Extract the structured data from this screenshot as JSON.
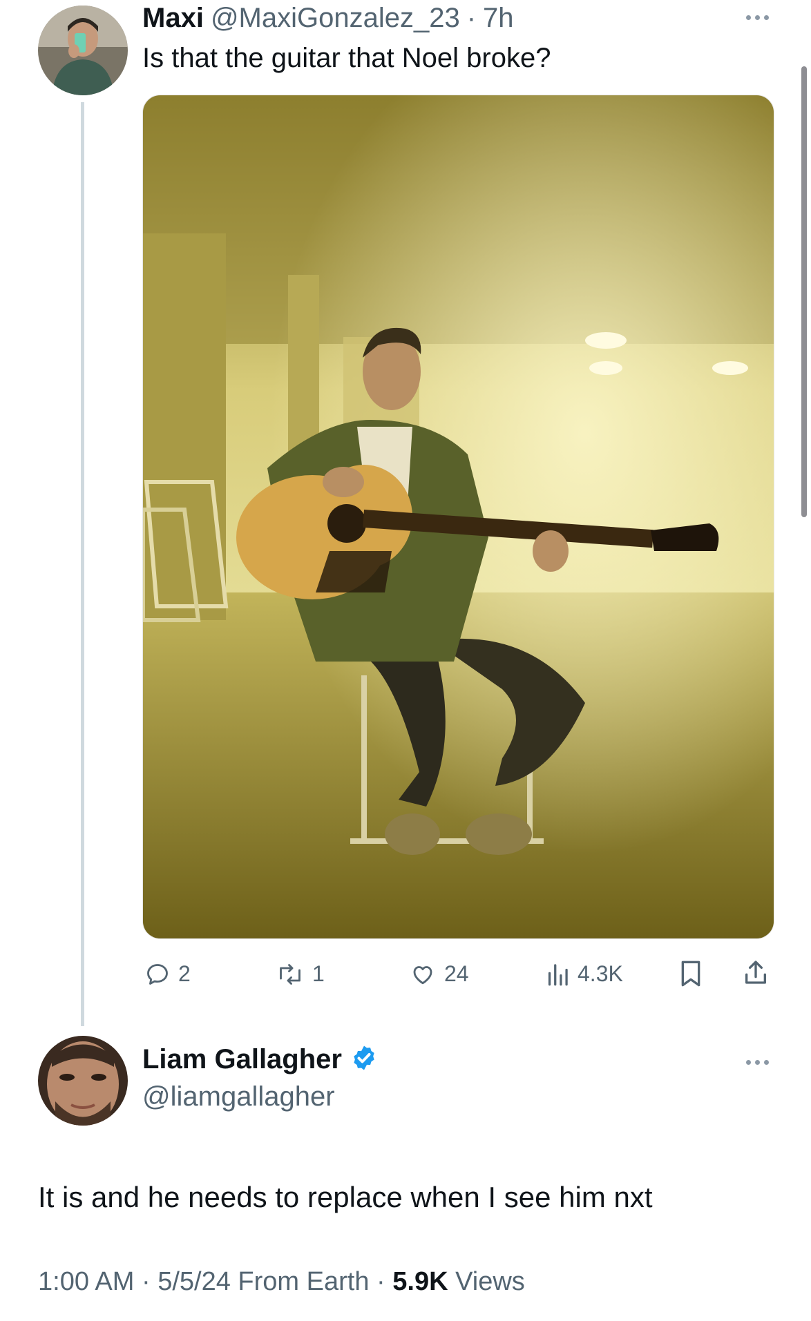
{
  "reply_tweet": {
    "author_name": "Maxi",
    "author_handle": "@MaxiGonzalez_23",
    "separator": "·",
    "time": "7h",
    "text": "Is that the guitar that Noel broke?",
    "actions": {
      "replies": "2",
      "retweets": "1",
      "likes": "24",
      "views": "4.3K"
    }
  },
  "main_tweet": {
    "author_name": "Liam Gallagher",
    "author_handle": "@liamgallagher",
    "text": "It is and he needs to replace when I see him nxt",
    "time": "1:00 AM",
    "sep1": "·",
    "date": "5/5/24",
    "source": "From Earth",
    "sep2": "·",
    "views": "5.9K",
    "views_label": "Views"
  },
  "icons": {
    "verified": "verified-badge-icon",
    "reply": "reply-icon",
    "retweet": "retweet-icon",
    "like": "heart-icon",
    "views": "views-chart-icon",
    "bookmark": "bookmark-icon",
    "share": "share-icon",
    "more": "more-icon"
  },
  "colors": {
    "verified": "#1d9bf0",
    "secondary_text": "#536471",
    "primary_text": "#0f1419",
    "photo_tone": "#c9b84a"
  }
}
